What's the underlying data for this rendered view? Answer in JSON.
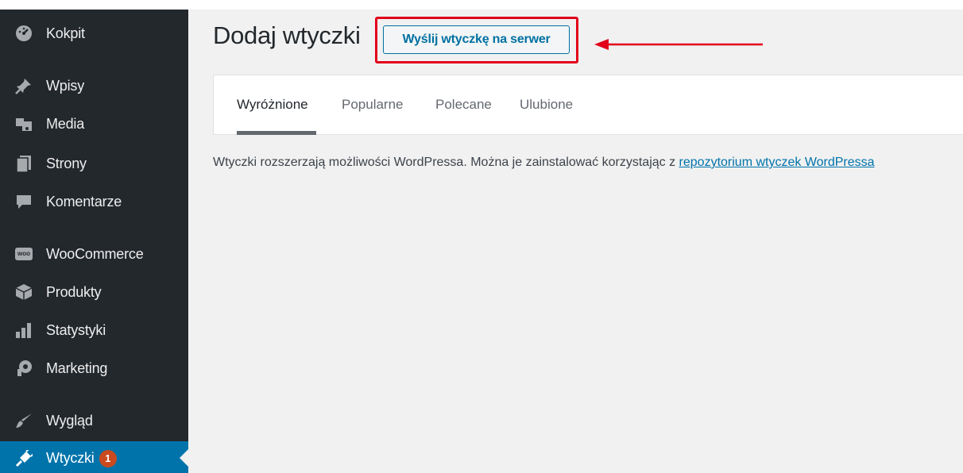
{
  "sidebar": {
    "items": [
      {
        "label": "Kokpit",
        "icon": "dashboard-icon"
      },
      {
        "label": "Wpisy",
        "icon": "pin-icon"
      },
      {
        "label": "Media",
        "icon": "media-icon"
      },
      {
        "label": "Strony",
        "icon": "pages-icon"
      },
      {
        "label": "Komentarze",
        "icon": "comments-icon"
      },
      {
        "label": "WooCommerce",
        "icon": "woocommerce-icon",
        "icon_text": "woo"
      },
      {
        "label": "Produkty",
        "icon": "products-icon"
      },
      {
        "label": "Statystyki",
        "icon": "stats-icon"
      },
      {
        "label": "Marketing",
        "icon": "megaphone-icon"
      },
      {
        "label": "Wygląd",
        "icon": "appearance-icon"
      },
      {
        "label": "Wtyczki",
        "icon": "plugins-icon",
        "badge": "1",
        "active": true
      }
    ]
  },
  "header": {
    "title": "Dodaj wtyczki",
    "upload_button": "Wyślij wtyczkę na serwer"
  },
  "tabs": [
    "Wyróżnione",
    "Popularne",
    "Polecane",
    "Ulubione"
  ],
  "description": {
    "text": "Wtyczki rozszerzają możliwości WordPressa. Można je zainstalować korzystając z ",
    "link": "repozytorium wtyczek WordPressa"
  },
  "colors": {
    "sidebar_bg": "#23282d",
    "active_bg": "#0073aa",
    "badge": "#ca4a1f",
    "annotation_red": "#e2001a",
    "link": "#0073aa"
  }
}
